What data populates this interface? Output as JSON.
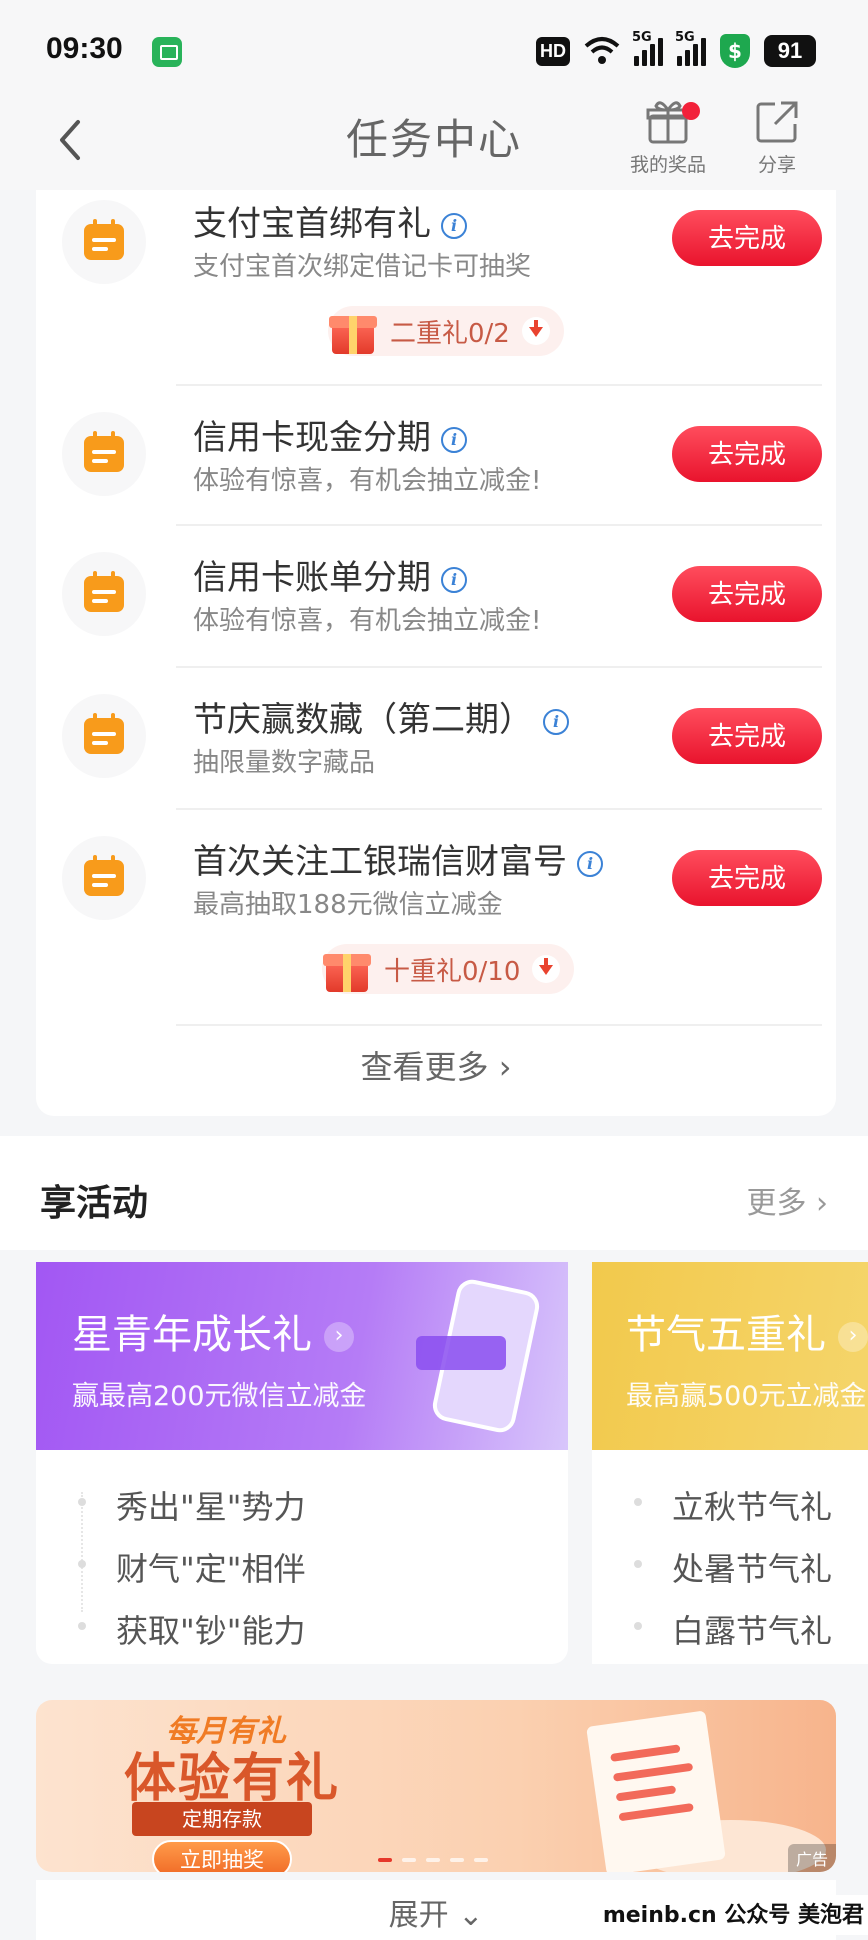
{
  "status_bar": {
    "time": "09:30",
    "hd": "HD",
    "net1": "5G",
    "net2": "5G",
    "battery": "91"
  },
  "nav": {
    "title": "任务中心",
    "prizes_label": "我的奖品",
    "share_label": "分享"
  },
  "tasks": [
    {
      "title": "支付宝首绑有礼",
      "subtitle": "支付宝首次绑定借记卡可抽奖",
      "button": "去完成",
      "gift": "二重礼0/2"
    },
    {
      "title": "信用卡现金分期",
      "subtitle": "体验有惊喜，有机会抽立减金!",
      "button": "去完成"
    },
    {
      "title": "信用卡账单分期",
      "subtitle": "体验有惊喜，有机会抽立减金!",
      "button": "去完成"
    },
    {
      "title": "节庆赢数藏（第二期）",
      "subtitle": "抽限量数字藏品",
      "button": "去完成"
    },
    {
      "title": "首次关注工银瑞信财富号",
      "subtitle": "最高抽取188元微信立减金",
      "button": "去完成",
      "gift": "十重礼0/10"
    }
  ],
  "view_more": "查看更多",
  "activities": {
    "title": "享活动",
    "more": "更多",
    "cards": [
      {
        "title": "星青年成长礼",
        "subtitle": "赢最高200元微信立减金",
        "items": [
          "秀出\"星\"势力",
          "财气\"定\"相伴",
          "获取\"钞\"能力"
        ],
        "color": "#a55bf0"
      },
      {
        "title": "节气五重礼",
        "subtitle": "最高赢500元立减金",
        "items": [
          "立秋节气礼",
          "处暑节气礼",
          "白露节气礼"
        ],
        "color": "#f2c94c"
      }
    ]
  },
  "banner": {
    "top": "每月有礼",
    "main": "体验有礼",
    "tag": "定期存款",
    "button": "立即抽奖",
    "ad": "广告"
  },
  "expand": "展开",
  "watermark": "meinb.cn  公众号 美泡君"
}
